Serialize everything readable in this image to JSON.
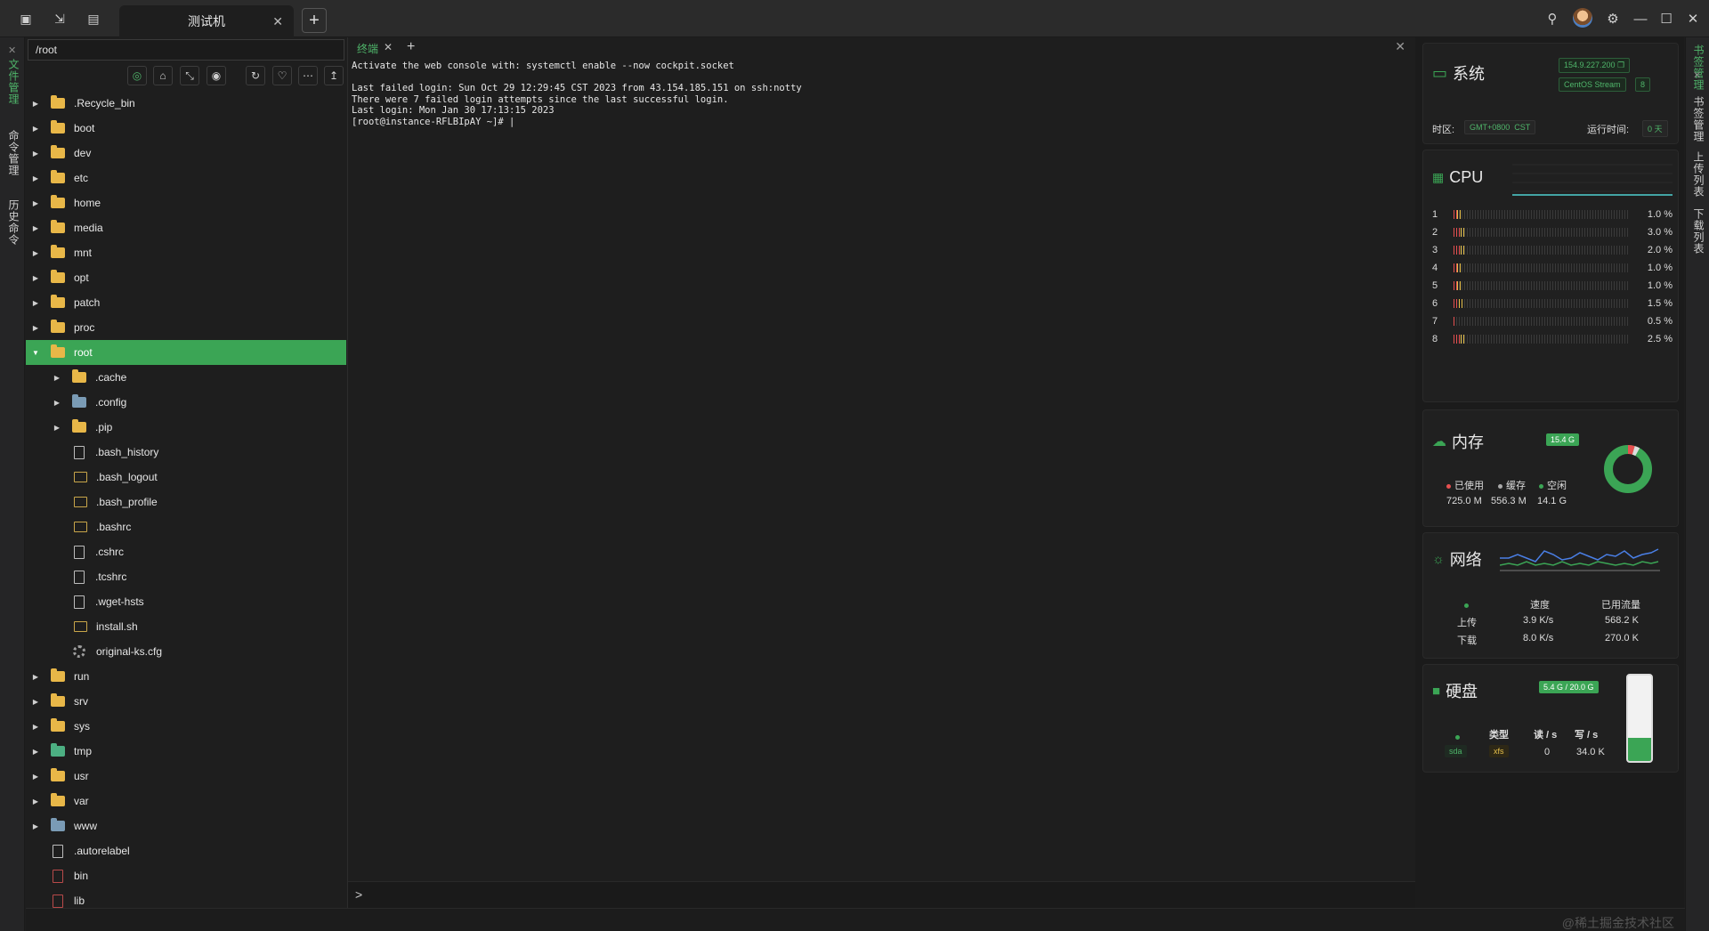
{
  "window": {
    "tab_title": "测试机",
    "watermark": "@稀土掘金技术社区"
  },
  "leftbar": {
    "labels": [
      "文件管理",
      "命令管理",
      "历史命令"
    ]
  },
  "rightbar": {
    "labels": [
      "书签管理",
      "上传列表",
      "下载列表"
    ]
  },
  "files": {
    "path": "/root",
    "tree": [
      {
        "name": ".Recycle_bin",
        "type": "folder",
        "depth": 0,
        "expandable": true
      },
      {
        "name": "boot",
        "type": "folder",
        "depth": 0,
        "expandable": true
      },
      {
        "name": "dev",
        "type": "folder",
        "depth": 0,
        "expandable": true
      },
      {
        "name": "etc",
        "type": "folder",
        "depth": 0,
        "expandable": true
      },
      {
        "name": "home",
        "type": "folder",
        "depth": 0,
        "expandable": true
      },
      {
        "name": "media",
        "type": "folder",
        "depth": 0,
        "expandable": true
      },
      {
        "name": "mnt",
        "type": "folder",
        "depth": 0,
        "expandable": true
      },
      {
        "name": "opt",
        "type": "folder",
        "depth": 0,
        "expandable": true
      },
      {
        "name": "patch",
        "type": "folder",
        "depth": 0,
        "expandable": true
      },
      {
        "name": "proc",
        "type": "folder",
        "depth": 0,
        "expandable": true
      },
      {
        "name": "root",
        "type": "folder",
        "depth": 0,
        "expandable": true,
        "expanded": true,
        "selected": true
      },
      {
        "name": ".cache",
        "type": "folder",
        "depth": 1,
        "expandable": true
      },
      {
        "name": ".config",
        "type": "folder-link",
        "depth": 1,
        "expandable": true
      },
      {
        "name": ".pip",
        "type": "folder",
        "depth": 1,
        "expandable": true
      },
      {
        "name": ".bash_history",
        "type": "file",
        "depth": 1
      },
      {
        "name": ".bash_logout",
        "type": "script",
        "depth": 1
      },
      {
        "name": ".bash_profile",
        "type": "script",
        "depth": 1
      },
      {
        "name": ".bashrc",
        "type": "script",
        "depth": 1
      },
      {
        "name": ".cshrc",
        "type": "file",
        "depth": 1
      },
      {
        "name": ".tcshrc",
        "type": "file",
        "depth": 1
      },
      {
        "name": ".wget-hsts",
        "type": "file",
        "depth": 1
      },
      {
        "name": "install.sh",
        "type": "script",
        "depth": 1
      },
      {
        "name": "original-ks.cfg",
        "type": "gear",
        "depth": 1
      },
      {
        "name": "run",
        "type": "folder",
        "depth": 0,
        "expandable": true
      },
      {
        "name": "srv",
        "type": "folder",
        "depth": 0,
        "expandable": true
      },
      {
        "name": "sys",
        "type": "folder",
        "depth": 0,
        "expandable": true
      },
      {
        "name": "tmp",
        "type": "folder-tmp",
        "depth": 0,
        "expandable": true
      },
      {
        "name": "usr",
        "type": "folder",
        "depth": 0,
        "expandable": true
      },
      {
        "name": "var",
        "type": "folder",
        "depth": 0,
        "expandable": true
      },
      {
        "name": "www",
        "type": "folder-link",
        "depth": 0,
        "expandable": true
      },
      {
        "name": ".autorelabel",
        "type": "file",
        "depth": 0
      },
      {
        "name": "bin",
        "type": "file-red",
        "depth": 0
      },
      {
        "name": "lib",
        "type": "file-red",
        "depth": 0
      }
    ]
  },
  "terminal": {
    "tab_label": "终端",
    "lines": [
      "Activate the web console with: systemctl enable --now cockpit.socket",
      "",
      "Last failed login: Sun Oct 29 12:29:45 CST 2023 from 43.154.185.151 on ssh:notty",
      "There were 7 failed login attempts since the last successful login.",
      "Last login: Mon Jan 30 17:13:15 2023",
      "[root@instance-RFLBIpAY ~]# |"
    ]
  },
  "system": {
    "title": "系统",
    "ip": "154.9.227.200",
    "os": "CentOS Stream",
    "os_version": "8",
    "timezone_label": "时区:",
    "timezone": "GMT+0800",
    "tz_abbr": "CST",
    "uptime_label": "运行时间:",
    "uptime": "0 天"
  },
  "cpu": {
    "title": "CPU",
    "cores": [
      {
        "n": "1",
        "pct": "1.0 %",
        "v": 1.0
      },
      {
        "n": "2",
        "pct": "3.0 %",
        "v": 3.0
      },
      {
        "n": "3",
        "pct": "2.0 %",
        "v": 2.0
      },
      {
        "n": "4",
        "pct": "1.0 %",
        "v": 1.0
      },
      {
        "n": "5",
        "pct": "1.0 %",
        "v": 1.0
      },
      {
        "n": "6",
        "pct": "1.5 %",
        "v": 1.5
      },
      {
        "n": "7",
        "pct": "0.5 %",
        "v": 0.5
      },
      {
        "n": "8",
        "pct": "2.5 %",
        "v": 2.5
      }
    ]
  },
  "memory": {
    "title": "内存",
    "total": "15.4 G",
    "used_label": "已使用",
    "cache_label": "缓存",
    "free_label": "空闲",
    "used": "725.0 M",
    "cache": "556.3 M",
    "free": "14.1 G",
    "used_frac": 0.046,
    "cache_frac": 0.035
  },
  "network": {
    "title": "网络",
    "speed_label": "速度",
    "traffic_label": "已用流量",
    "up_label": "上传",
    "down_label": "下载",
    "up_speed": "3.9 K/s",
    "down_speed": "8.0 K/s",
    "up_total": "568.2 K",
    "down_total": "270.0 K"
  },
  "disk": {
    "title": "硬盘",
    "usage": "5.4 G / 20.0 G",
    "type_label": "类型",
    "read_label": "读 / s",
    "write_label": "写 / s",
    "device": "sda",
    "fs": "xfs",
    "read": "0",
    "write": "34.0 K",
    "used_frac": 0.27
  },
  "colors": {
    "accent": "#3ba555",
    "folder": "#e8b748",
    "cpu_red": "#e65050",
    "cpu_yellow": "#e6c04a",
    "net_blue": "#4a7fe6",
    "net_green": "#3ba555"
  }
}
